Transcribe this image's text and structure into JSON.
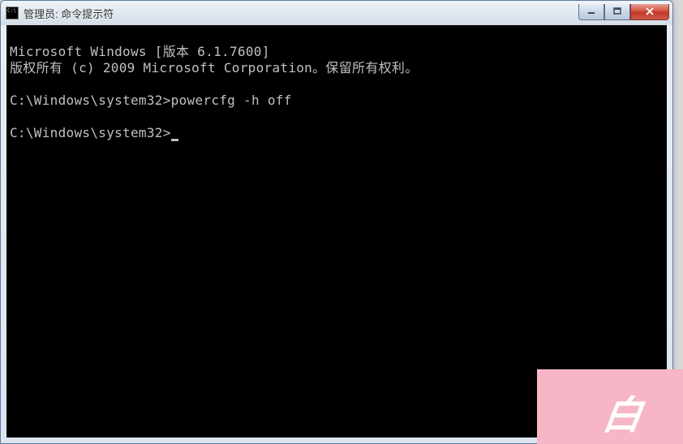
{
  "window": {
    "title": "管理员: 命令提示符"
  },
  "terminal": {
    "line1": "Microsoft Windows [版本 6.1.7600]",
    "line2": "版权所有 (c) 2009 Microsoft Corporation。保留所有权利。",
    "blank1": "",
    "prompt1": "C:\\Windows\\system32>",
    "command1": "powercfg -h off",
    "blank2": "",
    "prompt2": "C:\\Windows\\system32>"
  },
  "overlay": {
    "mark": "白"
  }
}
